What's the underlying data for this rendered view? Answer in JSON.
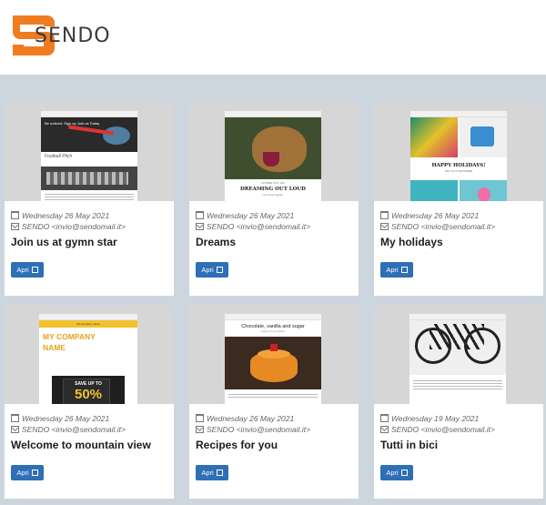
{
  "brand": {
    "name": "SENDO",
    "accent": "#f07c22"
  },
  "cards": [
    {
      "date": "Wednesday 26 May 2021",
      "sender": "SENDO <invio@sendomail.it>",
      "title": "Join us at gymn star",
      "button": "Apri",
      "preview_text": "Be noticed: Sign up Join us Today"
    },
    {
      "date": "Wednesday 26 May 2021",
      "sender": "SENDO <invio@sendomail.it>",
      "title": "Dreams",
      "button": "Apri",
      "preview_text": "DREAMING OUT LOUD"
    },
    {
      "date": "Wednesday 26 May 2021",
      "sender": "SENDO <invio@sendomail.it>",
      "title": "My holidays",
      "button": "Apri",
      "preview_text": "HAPPY HOLIDAYS!"
    },
    {
      "date": "Wednesday 26 May 2021",
      "sender": "SENDO <invio@sendomail.it>",
      "title": "Welcome to mountain view",
      "button": "Apri",
      "preview_text": "MY COMPANY NAME",
      "preview_offer": "SAVE UP TO 50%"
    },
    {
      "date": "Wednesday 26 May 2021",
      "sender": "SENDO <invio@sendomail.it>",
      "title": "Recipes for you",
      "button": "Apri",
      "preview_text": "Chocolate, vanilla and sugar"
    },
    {
      "date": "Wednesday 19 May 2021",
      "sender": "SENDO <invio@sendomail.it>",
      "title": "Tutti in bici",
      "button": "Apri",
      "preview_text": ""
    }
  ]
}
